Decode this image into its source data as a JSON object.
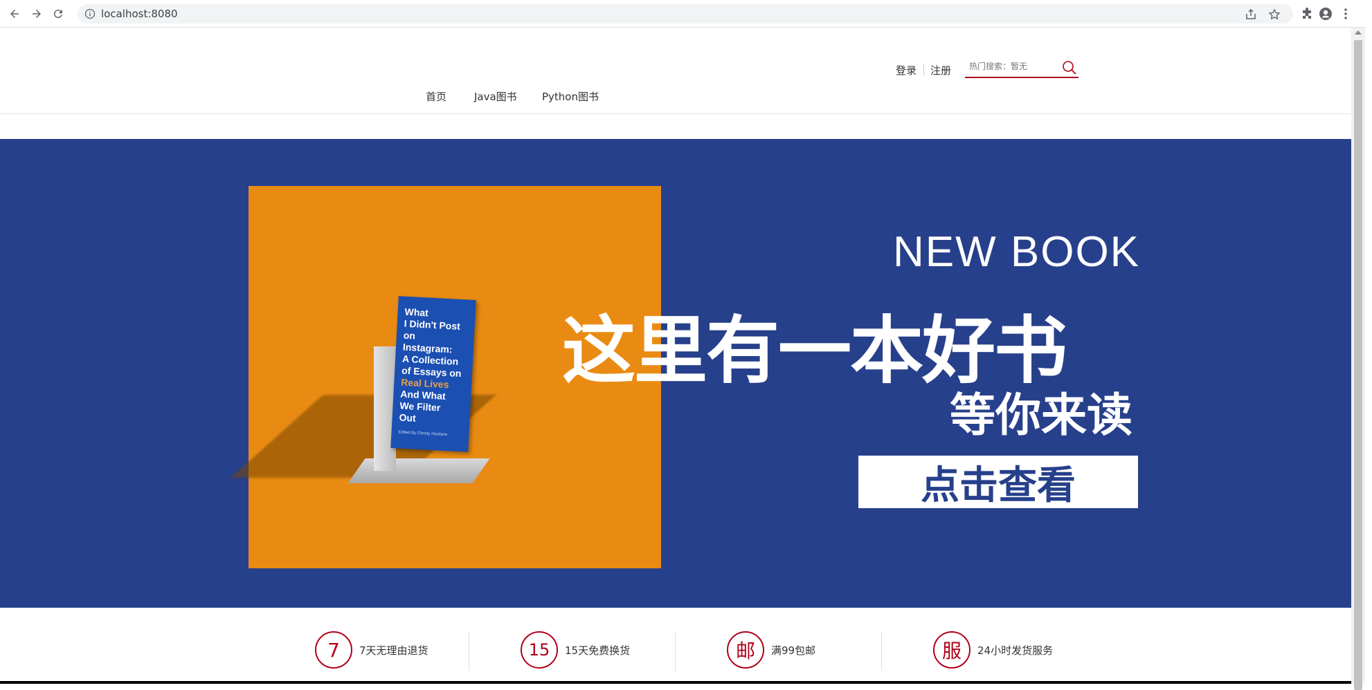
{
  "browser": {
    "url": "localhost:8080"
  },
  "header": {
    "login": "登录",
    "register": "注册",
    "search_placeholder": "热门搜索：暂无"
  },
  "nav": {
    "items": [
      {
        "label": "首页"
      },
      {
        "label": "Java图书"
      },
      {
        "label": "Python图书"
      }
    ]
  },
  "banner": {
    "book_title_lines": [
      "What",
      "I Didn't Post",
      "on Instagram:",
      "A Collection",
      "of Essays on"
    ],
    "book_accent": "Real Lives",
    "book_title_lines_2": [
      "And What",
      "We Filter",
      "Out"
    ],
    "book_author": "Edited By Christy Haubere",
    "new_book": "NEW BOOK",
    "headline": "这里有一本好书",
    "subhead": "等你来读",
    "cta": "点击查看",
    "colors": {
      "background": "#27408b",
      "panel": "#e98b12"
    }
  },
  "services": [
    {
      "icon": "7",
      "text": "7天无理由退货"
    },
    {
      "icon": "15",
      "text": "15天免费换货"
    },
    {
      "icon": "邮",
      "text": "满99包邮"
    },
    {
      "icon": "服",
      "text": "24小时发货服务"
    }
  ],
  "accent_color": "#b0001a"
}
